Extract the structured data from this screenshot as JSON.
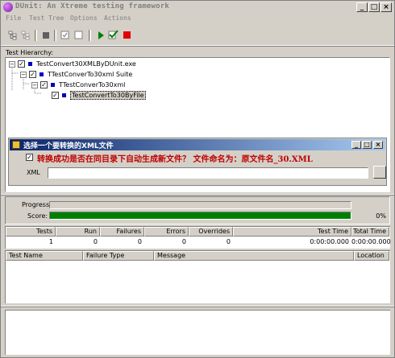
{
  "window": {
    "title": "DUnit: An Xtreme testing framework",
    "controls": [
      "_",
      "□",
      "×"
    ]
  },
  "menu": [
    "File",
    "Test Tree",
    "Options",
    "Actions"
  ],
  "toolbar": {
    "icons": [
      "select-all-icon",
      "deselect-all-icon",
      "stop-square-icon",
      "check-box-icon",
      "uncheck-box-icon",
      "run-icon",
      "run-selected-icon",
      "stop-icon"
    ]
  },
  "hierarchy": {
    "label": "Test Hierarchy:",
    "nodes": [
      {
        "label": "TestConvert30XMLByDUnit.exe",
        "expander": "−",
        "checked": true
      },
      {
        "label": "TTestConverTo30xml Suite",
        "expander": "−",
        "checked": true
      },
      {
        "label": "TTestConverTo30xml",
        "expander": "−",
        "checked": true
      },
      {
        "label": "TestConvertTo30ByFile",
        "expander": "",
        "checked": true,
        "selected": true
      }
    ]
  },
  "dialog": {
    "title": "选择一个要转换的XML文件",
    "checkbox_checked": true,
    "message": "转换成功是否在同目录下自动生成新文件？  文件命名为：原文件名_30.XML",
    "xml_label": "XML",
    "xml_value": ""
  },
  "progress": {
    "progress_label": "Progress:",
    "score_label": "Score:",
    "progress_value": 0,
    "score_value": 1.0,
    "progress_pct": "",
    "score_pct": "0%"
  },
  "stats": {
    "headers": [
      "Tests",
      "Run",
      "Failures",
      "Errors",
      "Overrides",
      "Test Time",
      "Total Time"
    ],
    "values": [
      "1",
      "0",
      "0",
      "0",
      "0",
      "0:00:00.000",
      "0:00:00.000"
    ]
  },
  "failures": {
    "headers": [
      "Test Name",
      "Failure Type",
      "Message",
      "Location"
    ]
  },
  "colors": {
    "title_inactive": "#808080",
    "dialog_title_start": "#0a246a",
    "dialog_title_end": "#a6caf0",
    "score_green": "#008000",
    "message_red": "#c00000",
    "tree_square": "#0000c0"
  }
}
